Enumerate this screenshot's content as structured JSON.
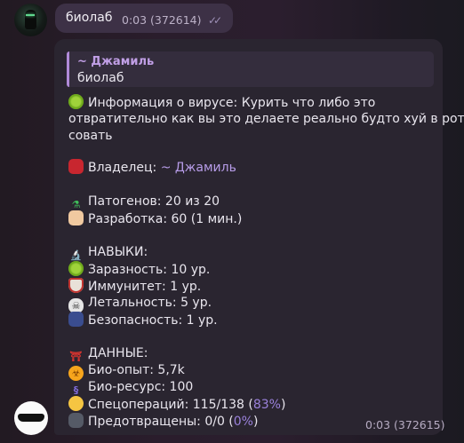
{
  "sent_message": {
    "text": "биолаб",
    "time": "0:03 (372614)",
    "status_icon": "double-check-icon"
  },
  "reply": {
    "quote": {
      "author": "~ Джамиль",
      "text": "биолаб"
    },
    "virus_info_line1": "Информация о вирусе: Курить что либо это",
    "virus_info_line2": "отвратительно как вы это делаете реально будто хуй в рот",
    "virus_info_line3": "совать",
    "owner_label": "Владелец:",
    "owner_name": "~ Джамиль",
    "pathogens": "Патогенов: 20 из 20",
    "development": "Разработка: 60 (1 мин.)",
    "skills_header": "НАВЫКИ:",
    "contagiousness": "Заразность: 10 ур.",
    "immunity": "Иммунитет: 1 ур.",
    "lethality": "Летальность: 5 ур.",
    "security": "Безопасность: 1 ур.",
    "data_header": "ДАННЫЕ:",
    "bio_experience": "Био-опыт: 5,7k",
    "bio_resource": "Био-ресурс: 100",
    "special_ops": "Спецопераций: 115/138 (",
    "special_ops_pct": "83%",
    "special_ops_close": ")",
    "prevented": "Предотвращены: 0/0 (",
    "prevented_pct": "0%",
    "prevented_close": ")",
    "time": "0:03 (372615)"
  },
  "icons": {
    "virus": "microbe-icon",
    "owner": "ogre-mask-icon",
    "pathogens": "test-tube-icon",
    "development": "scientist-icon",
    "skills": "microscope-icon",
    "immunity": "shield-icon",
    "lethality": "skull-crossbones-icon",
    "security": "police-officer-icon",
    "data": "torii-gate-icon",
    "bio_experience": "biohazard-icon",
    "bio_resource": "dna-icon",
    "special_ops": "grimacing-face-icon",
    "prevented": "goggles-icon"
  },
  "colors": {
    "link": "#b79ce8",
    "quote_bar": "#b08ad8",
    "bubble": "#2a2530",
    "sent_bubble": "#3d3146"
  }
}
